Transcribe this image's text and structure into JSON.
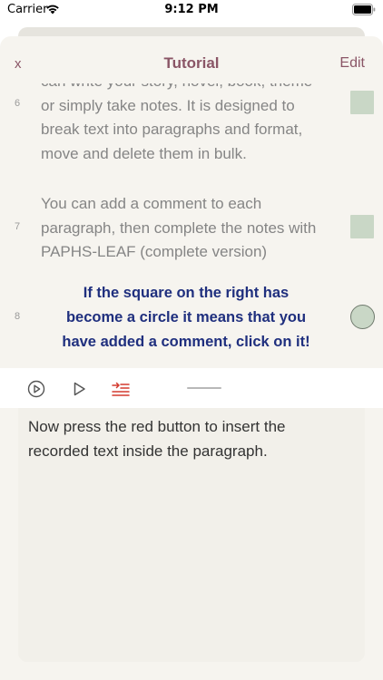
{
  "status_bar": {
    "carrier": "Carrier",
    "time": "9:12 PM",
    "wifi_icon": "wifi-icon",
    "battery_icon": "battery-icon"
  },
  "nav": {
    "close_label": "x",
    "title": "Tutorial",
    "edit_label": "Edit"
  },
  "paragraphs": [
    {
      "number": "6",
      "text": "can write your story, novel, book, theme\nor simply take notes. It is designed to\nbreak text into paragraphs and format,\nmove and delete them in bulk.",
      "indicator": "square",
      "highlighted": false
    },
    {
      "number": "7",
      "text": "You can add a comment to each\nparagraph, then complete the notes with\nPAPHS-LEAF (complete version)",
      "indicator": "square",
      "highlighted": false
    },
    {
      "number": "8",
      "text": "If the square on the right has\nbecome a circle it means that you\nhave added a comment, click on it!",
      "indicator": "circle",
      "highlighted": true
    }
  ],
  "toolbar": {
    "play_circle_icon": "play-circle-icon",
    "play_icon": "play-icon",
    "insert_icon": "insert-text-icon",
    "insert_color": "#d33a2f"
  },
  "note": {
    "text": "Now press the red button to insert the recorded text inside the paragraph."
  },
  "colors": {
    "accent": "#8a5566",
    "highlight_text": "#1f2f7e",
    "indicator_fill": "#c9d7c6",
    "sheet_bg": "#f6f4ef"
  }
}
